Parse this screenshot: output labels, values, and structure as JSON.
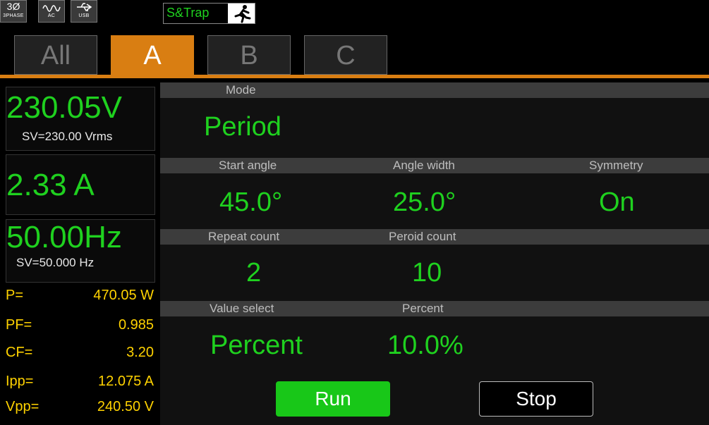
{
  "status": {
    "phase_big": "3Ø",
    "phase_small": "3PHASE",
    "ac_small": "AC",
    "usb_small": "USB",
    "strap_label": "S&Trap"
  },
  "tabs": [
    {
      "label": "All"
    },
    {
      "label": "A"
    },
    {
      "label": "B"
    },
    {
      "label": "C"
    }
  ],
  "measure": {
    "voltage": "230.05V",
    "voltage_sv": "SV=230.00 Vrms",
    "current": "2.33 A",
    "frequency": "50.00Hz",
    "frequency_sv": "SV=50.000  Hz"
  },
  "stats": [
    {
      "key": "P=",
      "value": "470.05 W"
    },
    {
      "key": "PF=",
      "value": "0.985"
    },
    {
      "key": "CF=",
      "value": "3.20"
    },
    {
      "key": "Ipp=",
      "value": "12.075 A"
    },
    {
      "key": "Vpp=",
      "value": "240.50 V"
    }
  ],
  "settings": {
    "mode_label": "Mode",
    "mode_value": "Period",
    "start_angle_label": "Start angle",
    "start_angle_value": "45.0°",
    "angle_width_label": "Angle width",
    "angle_width_value": "25.0°",
    "symmetry_label": "Symmetry",
    "symmetry_value": "On",
    "repeat_count_label": "Repeat count",
    "repeat_count_value": "2",
    "period_count_label": "Peroid count",
    "period_count_value": "10",
    "value_select_label": "Value select",
    "value_select_value": "Percent",
    "percent_label": "Percent",
    "percent_value": "10.0%"
  },
  "buttons": {
    "run": "Run",
    "stop": "Stop"
  },
  "colors": {
    "accent": "#d97e12",
    "value_green": "#1fd11f",
    "stat_yellow": "#ffd200"
  }
}
